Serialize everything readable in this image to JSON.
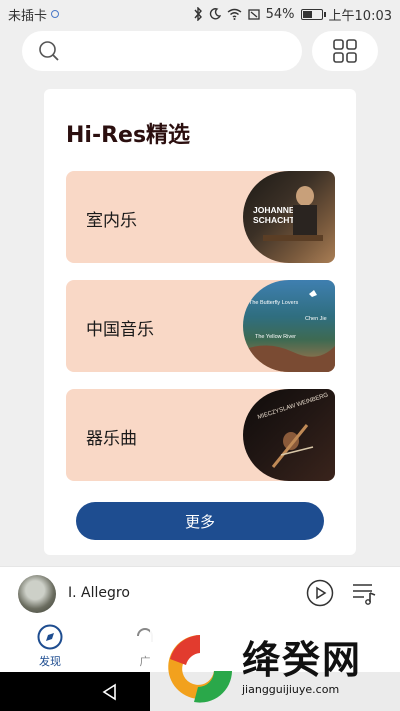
{
  "status": {
    "carrier": "未插卡",
    "battery": "54%",
    "time": "上午10:03",
    "battery_level": 0.54
  },
  "search": {
    "placeholder": ""
  },
  "section": {
    "title": "Hi-Res精选",
    "items": [
      {
        "label": "室内乐",
        "cover_text": [
          "JOHANNES X.",
          "SCHACHTNER"
        ]
      },
      {
        "label": "中国音乐",
        "cover_text": [
          "The Butterfly Lovers",
          "The Yellow River",
          "Chen Jie"
        ]
      },
      {
        "label": "器乐曲",
        "cover_text": [
          "MIECZYSLAW WEINBERG"
        ]
      }
    ],
    "more_label": "更多"
  },
  "player": {
    "track": "I. Allegro"
  },
  "tabs": [
    {
      "label": "发现",
      "active": true
    },
    {
      "label": "广"
    }
  ],
  "watermark": {
    "name": "绛癸网",
    "url": "jiangguijiuye.com"
  },
  "colors": {
    "accent": "#1e4d90",
    "row_bg": "#f9d8c6",
    "title": "#2b0f0f"
  }
}
